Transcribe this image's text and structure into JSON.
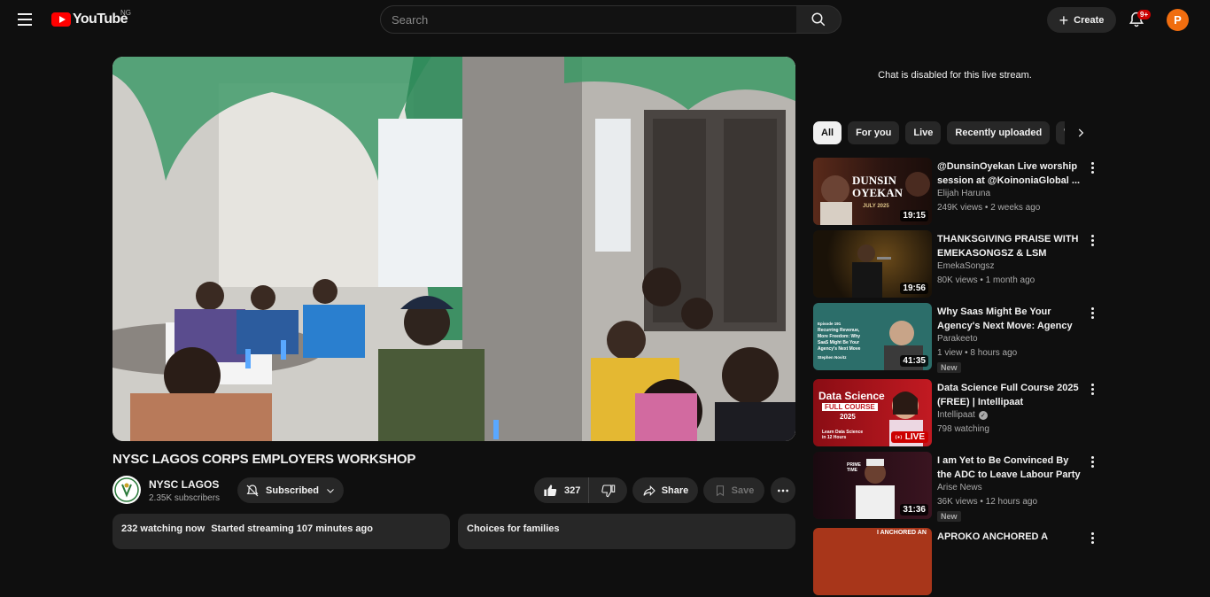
{
  "masthead": {
    "logo_text": "YouTube",
    "country_code": "NG",
    "search_placeholder": "Search",
    "create_label": "Create",
    "notification_badge": "9+",
    "avatar_letter": "P"
  },
  "video": {
    "title": "NYSC LAGOS CORPS EMPLOYERS WORKSHOP",
    "channel_name": "NYSC LAGOS",
    "subscribers": "2.35K subscribers",
    "subscribed_label": "Subscribed",
    "like_count": "327",
    "share_label": "Share",
    "save_label": "Save",
    "watching": "232 watching now",
    "started": "Started streaming 107 minutes ago",
    "families_title": "Choices for families"
  },
  "secondary": {
    "chat_disabled": "Chat is disabled for this live stream.",
    "chips": [
      "All",
      "For you",
      "Live",
      "Recently uploaded",
      "W"
    ],
    "recommendations": [
      {
        "title": "@DunsinOyekan  Live worship session at @KoinoniaGlobal ...",
        "channel": "Elijah Haruna",
        "views": "249K views",
        "age": "2 weeks ago",
        "duration": "19:15",
        "thumb_lines": [
          "DUNSIN",
          "OYEKAN"
        ],
        "thumb_sub": "JULY 2025",
        "verified": false,
        "is_new": false,
        "is_live": false
      },
      {
        "title": "THANKSGIVING PRAISE WITH EMEKASONGSZ & LSM",
        "channel": "EmekaSongsz",
        "views": "80K views",
        "age": "1 month ago",
        "duration": "19:56",
        "verified": false,
        "is_new": false,
        "is_live": false
      },
      {
        "title": "Why Saas Might Be Your Agency's Next Move: Agency ...",
        "channel": "Parakeeto",
        "views": "1 view",
        "age": "8 hours ago",
        "duration": "41:35",
        "thumb_lines": [
          "Episode 191",
          "Recurring Revenue,",
          "More Freedom: Why",
          "SaaS Might Be Your",
          "Agency's Next Move"
        ],
        "thumb_sub": "Stephen Novitz",
        "new_label": "New",
        "verified": false,
        "is_new": true,
        "is_live": false
      },
      {
        "title": "Data Science Full Course 2025 (FREE) | Intellipaat",
        "channel": "Intellipaat",
        "views": "798 watching",
        "age": "",
        "thumb_lines": [
          "Data Science",
          "FULL COURSE",
          "2025"
        ],
        "thumb_sub": "Learn Data Science in 12 Hours",
        "live_label": "LIVE",
        "verified": true,
        "is_new": false,
        "is_live": true
      },
      {
        "title": "I am Yet to Be Convinced By the ADC to Leave Labour Party - ...",
        "channel": "Arise News",
        "views": "36K views",
        "age": "12 hours ago",
        "duration": "31:36",
        "thumb_lines": [
          "PRIME",
          "TIME"
        ],
        "new_label": "New",
        "verified": false,
        "is_new": true,
        "is_live": false
      },
      {
        "title": "APROKO ANCHORED A",
        "channel": "",
        "views": "",
        "age": "",
        "thumb_lines": [
          "I ANCHORED AN"
        ],
        "verified": false,
        "is_new": false,
        "is_live": false
      }
    ]
  },
  "colors": {
    "background": "#0f0f0f",
    "surface": "#272727",
    "brand_red": "#ff0000",
    "avatar_orange": "#f06d0f",
    "text_secondary": "#aaaaaa"
  }
}
